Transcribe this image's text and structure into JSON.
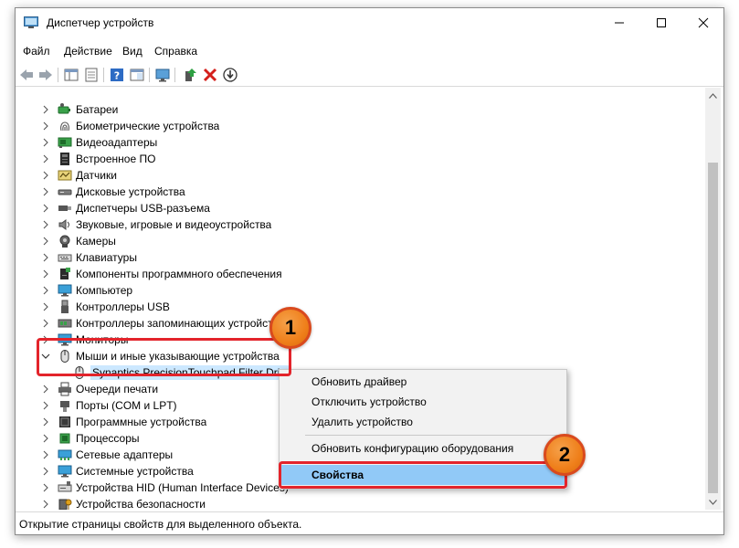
{
  "window": {
    "title": "Диспетчер устройств"
  },
  "menu": [
    "Файл",
    "Действие",
    "Вид",
    "Справка"
  ],
  "tree": {
    "items": [
      {
        "label": "Батареи",
        "icon": "battery-icon"
      },
      {
        "label": "Биометрические устройства",
        "icon": "fingerprint-icon"
      },
      {
        "label": "Видеоадаптеры",
        "icon": "display-adapter-icon"
      },
      {
        "label": "Встроенное ПО",
        "icon": "firmware-icon"
      },
      {
        "label": "Датчики",
        "icon": "sensor-icon"
      },
      {
        "label": "Дисковые устройства",
        "icon": "disk-drive-icon"
      },
      {
        "label": "Диспетчеры USB-разъема",
        "icon": "usb-connector-icon"
      },
      {
        "label": "Звуковые, игровые и видеоустройства",
        "icon": "speaker-icon"
      },
      {
        "label": "Камеры",
        "icon": "camera-icon"
      },
      {
        "label": "Клавиатуры",
        "icon": "keyboard-icon"
      },
      {
        "label": "Компоненты программного обеспечения",
        "icon": "software-component-icon"
      },
      {
        "label": "Компьютер",
        "icon": "computer-icon"
      },
      {
        "label": "Контроллеры USB",
        "icon": "usb-icon"
      },
      {
        "label": "Контроллеры запоминающих устройств",
        "icon": "storage-controller-icon"
      },
      {
        "label": "Мониторы",
        "icon": "monitor-icon"
      },
      {
        "label": "Мыши и иные указывающие устройства",
        "icon": "mouse-icon",
        "expanded": true
      },
      {
        "label": "Synaptics PrecisionTouchpad Filter Driver",
        "icon": "mouse-icon",
        "child": true,
        "selected": true
      },
      {
        "label": "Очереди печати",
        "icon": "printer-icon"
      },
      {
        "label": "Порты (COM и LPT)",
        "icon": "port-icon"
      },
      {
        "label": "Программные устройства",
        "icon": "software-device-icon"
      },
      {
        "label": "Процессоры",
        "icon": "processor-icon"
      },
      {
        "label": "Сетевые адаптеры",
        "icon": "network-adapter-icon"
      },
      {
        "label": "Системные устройства",
        "icon": "system-device-icon"
      },
      {
        "label": "Устройства HID (Human Interface Devices)",
        "icon": "hid-icon"
      },
      {
        "label": "Устройства безопасности",
        "icon": "security-device-icon"
      }
    ]
  },
  "context_menu": {
    "items": [
      {
        "label": "Обновить драйвер"
      },
      {
        "label": "Отключить устройство"
      },
      {
        "label": "Удалить устройство"
      },
      {
        "label": "Обновить конфигурацию оборудования"
      },
      {
        "label": "Свойства",
        "highlighted": true
      }
    ]
  },
  "status": {
    "text": "Открытие страницы свойств для выделенного объекта."
  },
  "callouts": {
    "one": "1",
    "two": "2"
  },
  "colors": {
    "callout_red": "#e3242b",
    "badge_orange": "#ef7f1a",
    "highlight_blue": "#91c9f7",
    "selected_blue": "#cce8ff"
  }
}
